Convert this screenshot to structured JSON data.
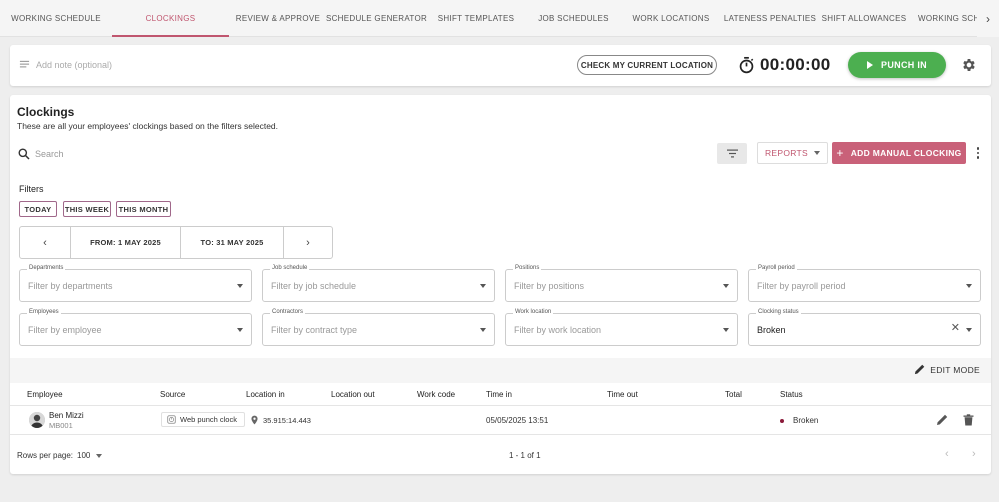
{
  "tabs": {
    "items": [
      "Working Schedule",
      "Clockings",
      "Review & Approve",
      "Schedule Generator",
      "Shift Templates",
      "Job Schedules",
      "Work Locations",
      "Lateness Penalties",
      "Shift Allowances",
      "Working Sche"
    ],
    "active": "Clockings"
  },
  "punch": {
    "note_placeholder": "Add note (optional)",
    "location_button": "CHECK MY CURRENT LOCATION",
    "timer": "00:00:00",
    "punch_button": "PUNCH IN"
  },
  "clockings": {
    "title": "Clockings",
    "subtitle": "These are all your employees' clockings based on the filters selected.",
    "search_placeholder": "Search",
    "reports_label": "REPORTS",
    "add_manual_label": "ADD MANUAL CLOCKING",
    "filters_label": "Filters",
    "quick_filters": [
      "TODAY",
      "THIS WEEK",
      "THIS MONTH"
    ],
    "date_from": "FROM: 1 MAY 2025",
    "date_to": "TO: 31 MAY 2025",
    "fields": {
      "departments": {
        "label": "Departments",
        "placeholder": "Filter by departments"
      },
      "job_schedule": {
        "label": "Job schedule",
        "placeholder": "Filter by job schedule"
      },
      "positions": {
        "label": "Positions",
        "placeholder": "Filter by positions"
      },
      "payroll_period": {
        "label": "Payroll period",
        "placeholder": "Filter by payroll period"
      },
      "employees": {
        "label": "Employees",
        "placeholder": "Filter by employee"
      },
      "contractors": {
        "label": "Contractors",
        "placeholder": "Filter by contract type"
      },
      "work_location": {
        "label": "Work location",
        "placeholder": "Filter by work location"
      },
      "clocking_status": {
        "label": "Clocking status",
        "value": "Broken"
      }
    },
    "edit_mode_label": "EDIT MODE",
    "columns": [
      "Employee",
      "Source",
      "Location in",
      "Location out",
      "Work code",
      "Time in",
      "Time out",
      "Total",
      "Status"
    ],
    "rows": [
      {
        "employee_name": "Ben Mizzi",
        "employee_code": "MB001",
        "source": "Web punch clock",
        "location_in": "35.915:14.443",
        "location_out": "",
        "work_code": "",
        "time_in": "05/05/2025 13:51",
        "time_out": "",
        "total": "",
        "status": "Broken"
      }
    ],
    "rows_per_page_label": "Rows per page:",
    "rows_per_page_value": "100",
    "page_count": "1 - 1 of 1"
  },
  "colors": {
    "accent": "#c0566f",
    "add_button": "#c96179",
    "punch_green": "#4caf50",
    "broken_dot": "#8b1a3a"
  }
}
